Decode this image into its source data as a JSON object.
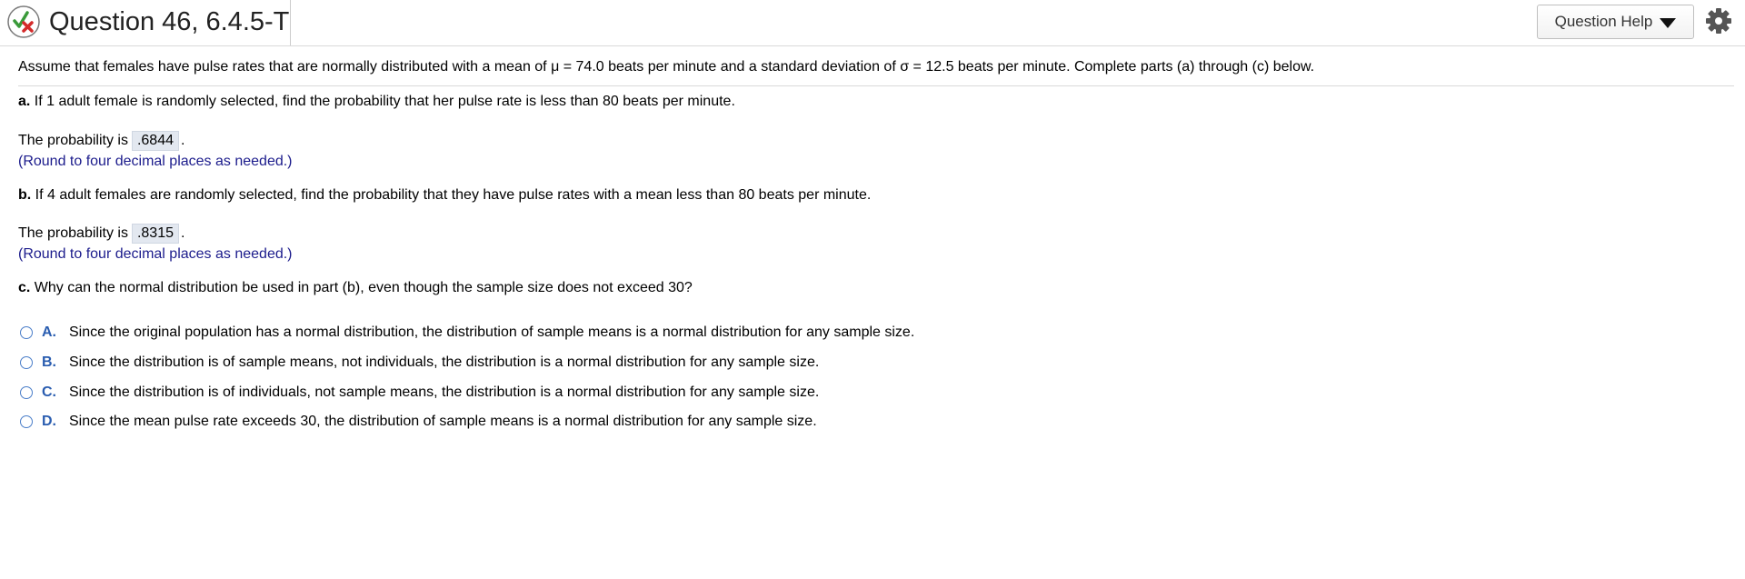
{
  "header": {
    "title": "Question 46, 6.4.5-T",
    "help_label": "Question Help",
    "status_icon": "partially-correct-icon",
    "settings_icon": "gear-icon"
  },
  "stem": {
    "text": "Assume that females have pulse rates that are normally distributed with a mean of μ = 74.0 beats per minute and a standard deviation of σ = 12.5 beats per minute. Complete parts (a) through (c) below."
  },
  "part_a": {
    "label": "a.",
    "question": "If 1 adult female is randomly selected, find the probability that her pulse rate is less than 80 beats per minute.",
    "answer_prefix": "The probability is",
    "answer_value": ".6844",
    "answer_suffix": ".",
    "hint": "(Round to four decimal places as needed.)"
  },
  "part_b": {
    "label": "b.",
    "question": "If 4 adult females are randomly selected, find the probability that they have pulse rates with a mean less than 80 beats per minute.",
    "answer_prefix": "The probability is",
    "answer_value": ".8315",
    "answer_suffix": ".",
    "hint": "(Round to four decimal places as needed.)"
  },
  "part_c": {
    "label": "c.",
    "question": "Why can the normal distribution be used in part (b), even though the sample size does not exceed 30?",
    "choices": [
      {
        "letter": "A.",
        "text": "Since the original population has a normal distribution, the distribution of sample means is a normal distribution for any sample size."
      },
      {
        "letter": "B.",
        "text": "Since the distribution is of sample means, not individuals, the distribution is a normal distribution for any sample size."
      },
      {
        "letter": "C.",
        "text": "Since the distribution is of individuals, not sample means, the distribution is a normal distribution for any sample size."
      },
      {
        "letter": "D.",
        "text": "Since the mean pulse rate exceeds 30, the distribution of sample means is a normal distribution for any sample size."
      }
    ]
  },
  "colors": {
    "accent_blue": "#2a5db0",
    "hint_color": "#1c1c8c",
    "answer_box_bg": "#e3e8f0",
    "correct_green": "#3a9a3a",
    "incorrect_red": "#d42b2b"
  }
}
